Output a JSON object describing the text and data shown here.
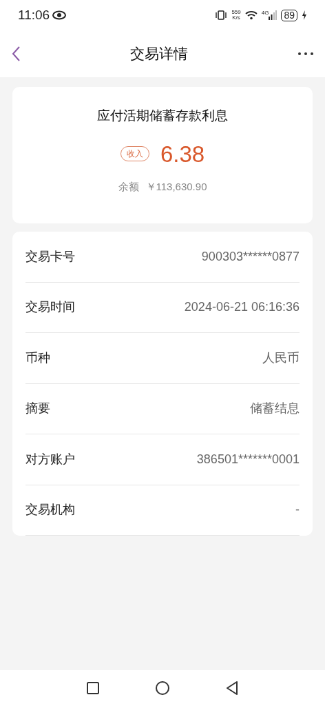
{
  "status_bar": {
    "time": "11:06",
    "speed_value": "559",
    "speed_unit": "K/s",
    "network": "4G",
    "battery": "89"
  },
  "header": {
    "title": "交易详情"
  },
  "summary": {
    "title": "应付活期储蓄存款利息",
    "tag": "收入",
    "amount": "6.38",
    "balance_label": "余额",
    "balance": "￥113,630.90"
  },
  "details": [
    {
      "label": "交易卡号",
      "value": "900303******0877"
    },
    {
      "label": "交易时间",
      "value": "2024-06-21 06:16:36"
    },
    {
      "label": "币种",
      "value": "人民币"
    },
    {
      "label": "摘要",
      "value": "储蓄结息"
    },
    {
      "label": "对方账户",
      "value": "386501*******0001"
    },
    {
      "label": "交易机构",
      "value": "-"
    }
  ]
}
